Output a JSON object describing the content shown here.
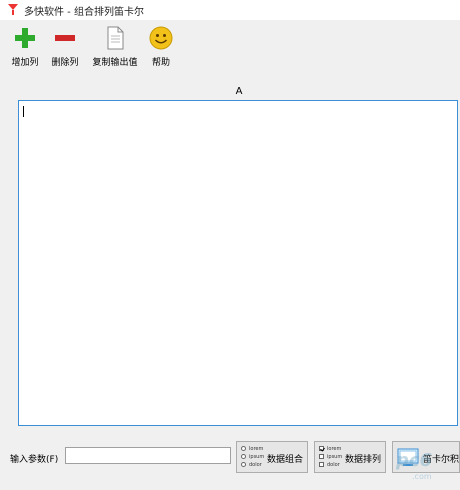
{
  "window": {
    "title": "多快软件 - 组合排列笛卡尔"
  },
  "toolbar": {
    "add_column": "增加列",
    "delete_column": "删除列",
    "copy_output": "复制输出值",
    "help": "帮助"
  },
  "grid": {
    "column_header": "A",
    "content": ""
  },
  "bottom": {
    "param_label": "输入参数(F)",
    "param_value": "",
    "combine_label": "数据组合",
    "permute_label": "数据排列",
    "cartesian_label": "笛卡尔积",
    "mini_options": [
      "lorem",
      "ipsum",
      "dolor"
    ]
  },
  "watermark": {
    "main": "pc6",
    "sub": ".com"
  },
  "colors": {
    "add": "#2eaa2e",
    "delete": "#d02828",
    "help": "#f2c21a",
    "accent": "#3c8fd4"
  }
}
